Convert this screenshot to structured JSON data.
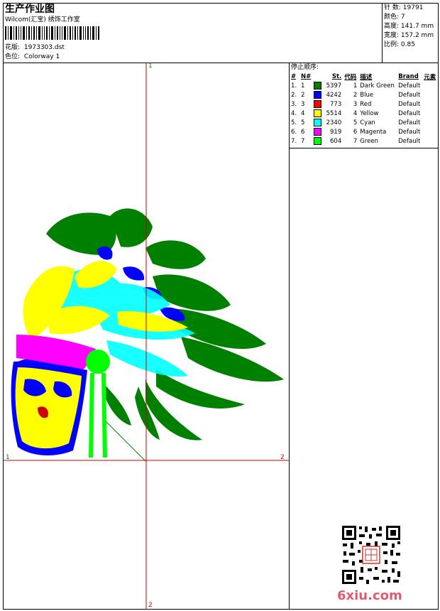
{
  "header": {
    "title": "生产作业图",
    "company": "Wilcom(汇宝) 绣饰工作室",
    "design_label": "花版:",
    "design_value": "1973303.dst",
    "colorway_label": "色位:",
    "colorway_value": "Colorway 1"
  },
  "stats": [
    {
      "label": "针 数:",
      "value": "19791"
    },
    {
      "label": "颜色:",
      "value": "7"
    },
    {
      "label": "高度:",
      "value": "141.7 mm"
    },
    {
      "label": "宽度:",
      "value": "157.2 mm"
    },
    {
      "label": "比例:",
      "value": "0.85"
    }
  ],
  "sequence": {
    "title": "停止顺序:",
    "headers": [
      "#",
      "N#",
      "St.",
      "代码",
      "描述",
      "Brand",
      "元素"
    ],
    "rows": [
      {
        "idx": "1.",
        "n": "1",
        "color": "#008000",
        "st": "5397",
        "code": "1",
        "desc": "Dark Green",
        "brand": "Default"
      },
      {
        "idx": "2.",
        "n": "2",
        "color": "#0000ff",
        "st": "4242",
        "code": "2",
        "desc": "Blue",
        "brand": "Default"
      },
      {
        "idx": "3.",
        "n": "3",
        "color": "#ff0000",
        "st": "773",
        "code": "3",
        "desc": "Red",
        "brand": "Default"
      },
      {
        "idx": "4.",
        "n": "4",
        "color": "#ffff00",
        "st": "5514",
        "code": "4",
        "desc": "Yellow",
        "brand": "Default"
      },
      {
        "idx": "5.",
        "n": "5",
        "color": "#00ffff",
        "st": "2340",
        "code": "5",
        "desc": "Cyan",
        "brand": "Default"
      },
      {
        "idx": "6.",
        "n": "6",
        "color": "#ff00ff",
        "st": "919",
        "code": "6",
        "desc": "Magenta",
        "brand": "Default"
      },
      {
        "idx": "7.",
        "n": "7",
        "color": "#00ff00",
        "st": "604",
        "code": "7",
        "desc": "Green",
        "brand": "Default"
      }
    ]
  },
  "axes": {
    "top": "1",
    "bottom": "2",
    "left": "1",
    "right": "2"
  },
  "watermark": "6xiu.com",
  "colors": {
    "axis": "#cc0000",
    "axis_label": "#008000"
  }
}
